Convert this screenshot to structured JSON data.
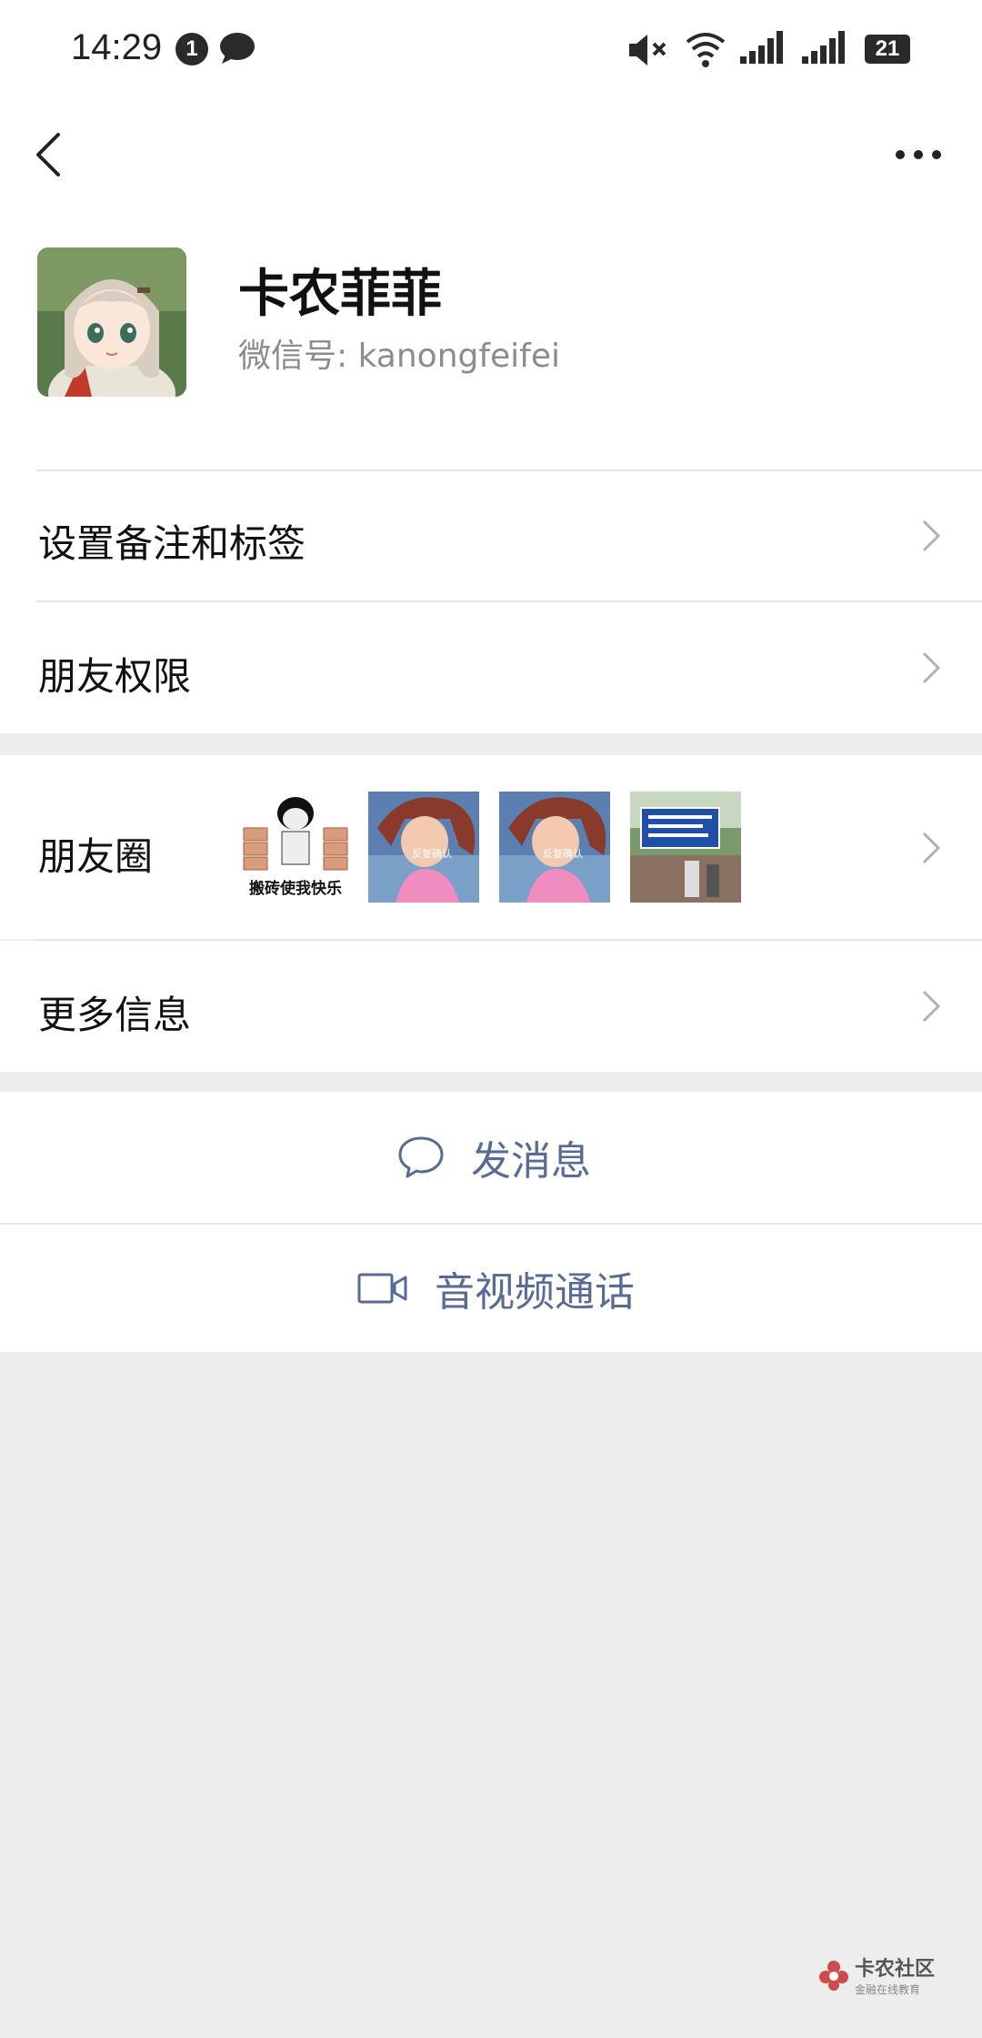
{
  "status_bar": {
    "time": "14:29",
    "notification_count": "1",
    "battery": "21"
  },
  "profile": {
    "nickname": "卡农菲菲",
    "wechat_id": "微信号:  kanongfeifei"
  },
  "rows": {
    "remark_tags": "设置备注和标签",
    "friend_permissions": "朋友权限",
    "moments": "朋友圈",
    "more_info": "更多信息"
  },
  "moments_thumbs": [
    {
      "caption": "搬砖使我快乐",
      "icon": "meme-brick-thumbnail"
    },
    {
      "caption": "反复确认",
      "icon": "cartoon-girl-thumbnail"
    },
    {
      "caption": "反复确认",
      "icon": "cartoon-girl-thumbnail"
    },
    {
      "caption": "",
      "icon": "street-sign-photo-thumbnail"
    }
  ],
  "actions": {
    "send_message": "发消息",
    "av_call": "音视频通话"
  },
  "watermark": {
    "title": "卡农社区",
    "subtitle": "金融在线教育"
  },
  "colors": {
    "accent_link": "#576b95",
    "background": "#ededed",
    "surface": "#ffffff"
  }
}
